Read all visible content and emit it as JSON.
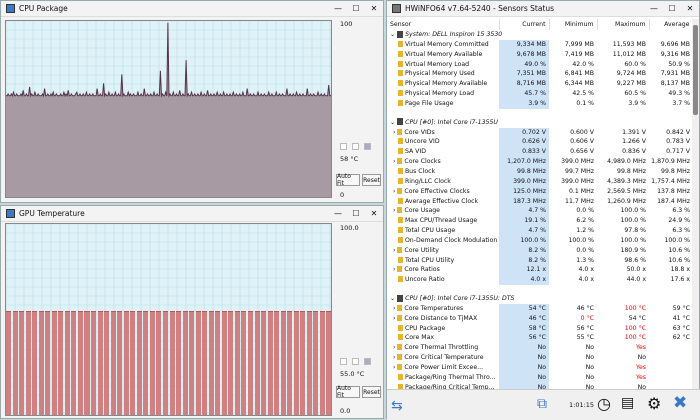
{
  "cpu_window": {
    "title": "CPU Package",
    "scale_max": "100",
    "current": "58 °C",
    "scale_min": "0",
    "auto_fit": "Auto Fit",
    "reset": "Reset"
  },
  "gpu_window": {
    "title": "GPU Temperature",
    "scale_max": "100.0",
    "current": "55.0 °C",
    "scale_min": "0.0",
    "auto_fit": "Auto Fit",
    "reset": "Reset"
  },
  "sensor_window": {
    "title": "HWiNFO64 v7.64-5240 - Sensors Status",
    "columns": [
      "Sensor",
      "Current",
      "Minimum",
      "Maximum",
      "Average"
    ],
    "timer": "1:01:15",
    "rows": [
      {
        "type": "group",
        "name": "System: DELL Inspiron 15 3530"
      },
      {
        "name": "Virtual Memory Committed",
        "cur": "9,334 MB",
        "min": "7,999 MB",
        "max": "11,593 MB",
        "avg": "9,696 MB"
      },
      {
        "name": "Virtual Memory Available",
        "cur": "9,678 MB",
        "min": "7,419 MB",
        "max": "11,012 MB",
        "avg": "9,316 MB"
      },
      {
        "name": "Virtual Memory Load",
        "cur": "49.0 %",
        "min": "42.0 %",
        "max": "60.0 %",
        "avg": "50.9 %"
      },
      {
        "name": "Physical Memory Used",
        "cur": "7,351 MB",
        "min": "6,841 MB",
        "max": "9,724 MB",
        "avg": "7,931 MB"
      },
      {
        "name": "Physical Memory Available",
        "cur": "8,716 MB",
        "min": "6,344 MB",
        "max": "9,227 MB",
        "avg": "8,137 MB"
      },
      {
        "name": "Physical Memory Load",
        "cur": "45.7 %",
        "min": "42.5 %",
        "max": "60.5 %",
        "avg": "49.3 %"
      },
      {
        "name": "Page File Usage",
        "cur": "3.9 %",
        "min": "0.1 %",
        "max": "3.9 %",
        "avg": "3.7 %"
      },
      {
        "type": "sep"
      },
      {
        "type": "group",
        "name": "CPU [#0]: Intel Core i7-1355U"
      },
      {
        "name": "Core VIDs",
        "exp": true,
        "cur": "0.702 V",
        "min": "0.600 V",
        "max": "1.391 V",
        "avg": "0.842 V"
      },
      {
        "name": "Uncore VID",
        "cur": "0.626 V",
        "min": "0.606 V",
        "max": "1.266 V",
        "avg": "0.783 V"
      },
      {
        "name": "SA VID",
        "cur": "0.833 V",
        "min": "0.656 V",
        "max": "0.836 V",
        "avg": "0.717 V"
      },
      {
        "name": "Core Clocks",
        "exp": true,
        "cur": "1,207.0 MHz",
        "min": "399.0 MHz",
        "max": "4,989.0 MHz",
        "avg": "1,870.9 MHz"
      },
      {
        "name": "Bus Clock",
        "cur": "99.8 MHz",
        "min": "99.7 MHz",
        "max": "99.8 MHz",
        "avg": "99.8 MHz"
      },
      {
        "name": "Ring/LLC Clock",
        "cur": "399.0 MHz",
        "min": "399.0 MHz",
        "max": "4,389.3 MHz",
        "avg": "1,757.4 MHz"
      },
      {
        "name": "Core Effective Clocks",
        "exp": true,
        "cur": "125.0 MHz",
        "min": "0.1 MHz",
        "max": "2,569.5 MHz",
        "avg": "137.8 MHz"
      },
      {
        "name": "Average Effective Clock",
        "cur": "187.3 MHz",
        "min": "11.7 MHz",
        "max": "1,260.9 MHz",
        "avg": "187.4 MHz"
      },
      {
        "name": "Core Usage",
        "exp": true,
        "cur": "4.7 %",
        "min": "0.0 %",
        "max": "100.0 %",
        "avg": "6.3 %"
      },
      {
        "name": "Max CPU/Thread Usage",
        "cur": "19.1 %",
        "min": "6.2 %",
        "max": "100.0 %",
        "avg": "24.9 %"
      },
      {
        "name": "Total CPU Usage",
        "cur": "4.7 %",
        "min": "1.2 %",
        "max": "97.8 %",
        "avg": "6.3 %"
      },
      {
        "name": "On-Demand Clock Modulation",
        "cur": "100.0 %",
        "min": "100.0 %",
        "max": "100.0 %",
        "avg": "100.0 %"
      },
      {
        "name": "Core Utility",
        "exp": true,
        "cur": "8.2 %",
        "min": "0.0 %",
        "max": "180.9 %",
        "avg": "10.6 %"
      },
      {
        "name": "Total CPU Utility",
        "cur": "8.2 %",
        "min": "1.3 %",
        "max": "98.6 %",
        "avg": "10.6 %"
      },
      {
        "name": "Core Ratios",
        "exp": true,
        "cur": "12.1 x",
        "min": "4.0 x",
        "max": "50.0 x",
        "avg": "18.8 x"
      },
      {
        "name": "Uncore Ratio",
        "cur": "4.0 x",
        "min": "4.0 x",
        "max": "44.0 x",
        "avg": "17.6 x"
      },
      {
        "type": "sep"
      },
      {
        "type": "group",
        "name": "CPU [#0]: Intel Core i7-1355U: DTS"
      },
      {
        "name": "Core Temperatures",
        "exp": true,
        "cur": "54 °C",
        "min": "46 °C",
        "max": "100 °C",
        "avg": "59 °C",
        "maxred": true
      },
      {
        "name": "Core Distance to TjMAX",
        "exp": true,
        "cur": "46 °C",
        "min": "0 °C",
        "max": "54 °C",
        "avg": "41 °C",
        "minred": true
      },
      {
        "name": "CPU Package",
        "cur": "58 °C",
        "min": "56 °C",
        "max": "100 °C",
        "avg": "63 °C",
        "maxred": true
      },
      {
        "name": "Core Max",
        "cur": "56 °C",
        "min": "55 °C",
        "max": "100 °C",
        "avg": "62 °C",
        "maxred": true
      },
      {
        "name": "Core Thermal Throttling",
        "exp": true,
        "cur": "No",
        "min": "No",
        "max": "Yes",
        "avg": "",
        "maxred": true
      },
      {
        "name": "Core Critical Temperature",
        "exp": true,
        "cur": "No",
        "min": "No",
        "max": "No",
        "avg": ""
      },
      {
        "name": "Core Power Limit Excee...",
        "exp": true,
        "cur": "No",
        "min": "No",
        "max": "Yes",
        "avg": "",
        "maxred": true
      },
      {
        "name": "Package/Ring Thermal Thro...",
        "cur": "No",
        "min": "No",
        "max": "Yes",
        "avg": "",
        "maxred": true
      },
      {
        "name": "Package/Ring Critical Temp...",
        "cur": "No",
        "min": "No",
        "max": "No",
        "avg": ""
      }
    ]
  },
  "chart_data": [
    {
      "type": "line",
      "title": "CPU Package",
      "ylim": [
        0,
        100
      ],
      "series": [
        {
          "name": "CPU Package",
          "values": [
            58,
            58,
            59,
            58,
            58,
            59,
            58,
            60,
            58,
            58,
            59,
            58,
            58,
            58,
            59,
            58,
            61,
            58,
            58,
            59,
            58,
            58,
            63,
            58,
            59,
            58,
            58,
            60,
            58,
            58,
            59,
            58,
            58,
            58,
            59,
            58,
            62,
            58,
            58,
            59,
            58,
            58,
            59,
            58,
            60,
            58,
            58,
            59,
            58,
            58,
            58,
            59,
            58,
            58,
            60,
            58,
            59,
            58,
            61,
            58,
            58,
            59,
            58,
            58,
            58,
            59,
            60,
            58,
            58,
            59,
            58,
            58,
            59,
            58,
            58,
            60,
            58,
            58,
            59,
            58,
            58,
            59,
            58,
            58,
            58,
            62,
            58,
            58,
            59,
            58,
            58,
            65,
            58,
            59,
            58,
            58,
            60,
            58,
            58,
            59,
            58,
            58,
            60,
            58,
            58,
            59,
            58,
            58,
            70,
            58,
            59,
            58,
            58,
            58,
            60,
            58,
            59,
            58,
            58,
            59,
            58,
            58,
            58,
            60,
            58,
            58,
            59,
            58,
            58,
            62,
            58,
            58,
            59,
            58,
            58,
            59,
            58,
            58,
            60,
            58,
            58,
            59,
            58,
            58,
            72,
            58,
            59,
            58,
            58,
            60,
            58,
            99,
            58,
            59,
            58,
            58,
            60,
            58,
            58,
            59,
            58,
            58,
            61,
            58,
            58,
            59,
            58,
            58,
            78,
            58,
            59,
            58,
            58,
            60,
            58,
            58,
            59,
            58,
            58,
            59,
            58,
            58,
            60,
            58,
            58,
            59,
            58,
            58,
            61,
            58,
            58,
            59,
            58,
            58,
            59,
            58,
            58,
            60,
            58,
            58,
            59,
            58,
            58,
            60,
            58,
            58,
            59,
            58,
            58,
            59,
            58,
            58,
            60,
            58,
            58,
            59,
            58,
            58,
            59,
            58,
            58,
            60,
            58,
            58,
            58,
            62,
            58,
            58,
            59,
            58,
            58,
            59,
            58,
            58,
            58,
            60,
            58,
            58,
            59,
            58,
            58,
            59,
            58,
            58,
            58,
            60,
            58,
            58,
            59,
            58,
            58,
            58,
            60,
            58,
            58,
            59,
            58,
            58,
            59,
            58,
            58,
            58,
            62,
            58,
            58,
            59,
            58,
            58,
            59,
            58,
            58,
            60,
            58,
            58,
            59,
            58,
            58,
            59,
            58,
            58,
            58,
            62,
            58,
            58,
            59,
            58,
            58,
            59,
            58,
            58,
            58,
            60,
            58,
            58,
            59,
            58,
            58,
            59,
            58,
            58,
            58,
            64,
            58,
            58,
            59,
            58
          ]
        }
      ]
    },
    {
      "type": "bar",
      "title": "GPU Temperature",
      "ylim": [
        0,
        100
      ],
      "series": [
        {
          "name": "GPU Temperature",
          "values": [
            55,
            55,
            55,
            55,
            55,
            55,
            55,
            55,
            55,
            55,
            55,
            55,
            55,
            55,
            55,
            55,
            55,
            55,
            55,
            55,
            55,
            55,
            55,
            55,
            55,
            55,
            55,
            55,
            55,
            55,
            55,
            55,
            55,
            55,
            55,
            55,
            55,
            55,
            55,
            55,
            55,
            55,
            55,
            55,
            55,
            55,
            55,
            55,
            55,
            55
          ]
        }
      ]
    }
  ]
}
